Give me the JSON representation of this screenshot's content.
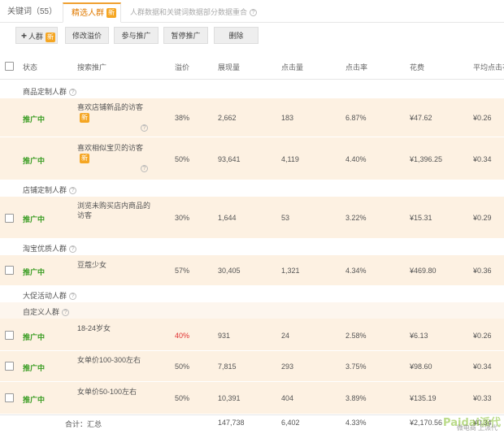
{
  "tabs": {
    "keywords": "关键词（55）",
    "crowd": "精选人群",
    "crowd_badge": "新",
    "hint": "人群数据和关键词数据部分数据重合"
  },
  "toolbar": {
    "add_label": "人群",
    "add_badge": "新",
    "edit_premium": "修改溢价",
    "join_promo": "参与推广",
    "pause_promo": "暂停推广",
    "delete": "删除"
  },
  "columns": [
    "状态",
    "搜索推广",
    "溢价",
    "展现量",
    "点击量",
    "点击率",
    "花费",
    "平均点击花"
  ],
  "groups": [
    {
      "label": "商品定制人群",
      "rows": [
        {
          "status": "推广中",
          "name": "喜欢店铺新品的访客",
          "badge": "新",
          "premium": "38%",
          "impressions": "2,662",
          "clicks": "183",
          "ctr": "6.87%",
          "cost": "¥47.62",
          "cpc": "¥0.26",
          "checkbox": false
        },
        {
          "status": "推广中",
          "name": "喜欢相似宝贝的访客",
          "badge": "新",
          "premium": "50%",
          "impressions": "93,641",
          "clicks": "4,119",
          "ctr": "4.40%",
          "cost": "¥1,396.25",
          "cpc": "¥0.34",
          "checkbox": false
        }
      ]
    },
    {
      "label": "店铺定制人群",
      "rows": [
        {
          "status": "推广中",
          "name": "浏览未购买店内商品的访客",
          "badge": "",
          "premium": "30%",
          "impressions": "1,644",
          "clicks": "53",
          "ctr": "3.22%",
          "cost": "¥15.31",
          "cpc": "¥0.29",
          "checkbox": true
        }
      ]
    },
    {
      "label": "淘宝优质人群",
      "rows": [
        {
          "status": "推广中",
          "name": "豆蔻少女",
          "badge": "",
          "premium": "57%",
          "impressions": "30,405",
          "clicks": "1,321",
          "ctr": "4.34%",
          "cost": "¥469.80",
          "cpc": "¥0.36",
          "checkbox": true
        }
      ]
    },
    {
      "label": "大促活动人群",
      "rows": []
    },
    {
      "label": "自定义人群",
      "rows": [
        {
          "status": "推广中",
          "name": "18-24岁女",
          "badge": "",
          "premium": "40%",
          "premium_red": true,
          "impressions": "931",
          "clicks": "24",
          "ctr": "2.58%",
          "cost": "¥6.13",
          "cpc": "¥0.26",
          "checkbox": true
        },
        {
          "status": "推广中",
          "name": "女单价100-300左右",
          "badge": "",
          "premium": "50%",
          "impressions": "7,815",
          "clicks": "293",
          "ctr": "3.75%",
          "cost": "¥98.60",
          "cpc": "¥0.34",
          "checkbox": true
        },
        {
          "status": "推广中",
          "name": "女单价50-100左右",
          "badge": "",
          "premium": "50%",
          "impressions": "10,391",
          "clicks": "404",
          "ctr": "3.89%",
          "cost": "¥135.19",
          "cpc": "¥0.33",
          "checkbox": true
        }
      ]
    }
  ],
  "total": {
    "label": "合计：汇总",
    "impressions": "147,738",
    "clicks": "6,402",
    "ctr": "4.33%",
    "cost": "¥2,170.56",
    "cpc": "¥0.34"
  },
  "watermark": {
    "brand": "Paidai派代",
    "sub": "微电商 上派代"
  },
  "colors": {
    "accent": "#f0a030",
    "row_bg": "#fdf1e2",
    "status": "#3a9d23",
    "badge": "#f5a623"
  }
}
